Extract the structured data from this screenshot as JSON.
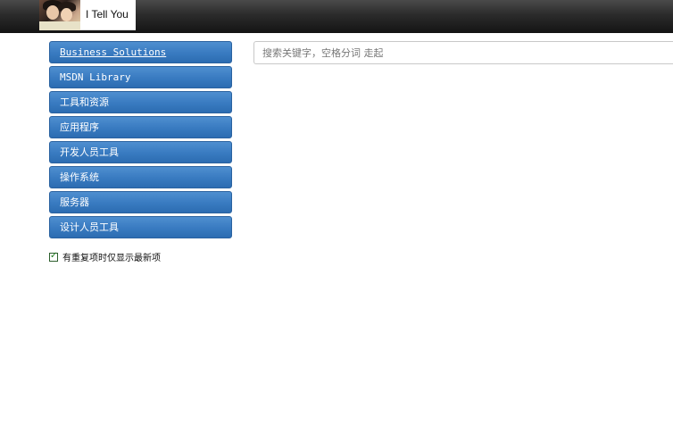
{
  "header": {
    "logo_text": "I Tell You",
    "background": "#1e1e1e"
  },
  "sidebar": {
    "accent": "#3a7cc2",
    "items": [
      {
        "label": "Business Solutions",
        "active": true
      },
      {
        "label": "MSDN Library"
      },
      {
        "label": "工具和资源"
      },
      {
        "label": "应用程序"
      },
      {
        "label": "开发人员工具"
      },
      {
        "label": "操作系统"
      },
      {
        "label": "服务器"
      },
      {
        "label": "设计人员工具"
      }
    ]
  },
  "filter": {
    "latest_only_label": "有重复项时仅显示最新项",
    "latest_only_checked": true
  },
  "search": {
    "placeholder": "搜索关键字，空格分词 走起",
    "value": ""
  }
}
